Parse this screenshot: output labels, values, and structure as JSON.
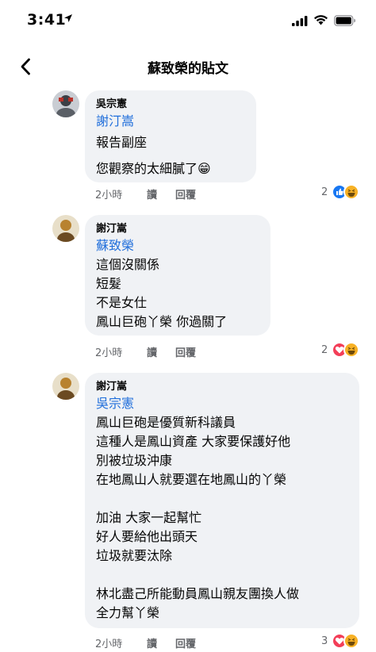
{
  "status": {
    "time": "3:41"
  },
  "nav": {
    "title": "蘇致榮的貼文"
  },
  "comments": [
    {
      "author": "吳宗憲",
      "mention": "謝汀嵩",
      "lines": [
        "報告副座",
        "您觀察的太細膩了😁"
      ],
      "time": "2小時",
      "reply_label": "讀",
      "replies_label": "回覆",
      "reaction_count": "2",
      "reactions": [
        "like",
        "haha"
      ]
    },
    {
      "author": "謝汀嵩",
      "mention": "蘇致榮",
      "lines": [
        "這個沒關係",
        "短髮",
        "不是女仕",
        "鳳山巨砲丫榮 你過關了"
      ],
      "time": "2小時",
      "reply_label": "讀",
      "replies_label": "回覆",
      "reaction_count": "2",
      "reactions": [
        "love",
        "haha"
      ]
    },
    {
      "author": "謝汀嵩",
      "mention": "吳宗憲",
      "lines": [
        "鳳山巨砲是優質新科議員",
        "這種人是鳳山資產 大家要保護好他",
        "別被垃圾沖康",
        "在地鳳山人就要選在地鳳山的丫榮",
        "",
        "加油 大家一起幫忙",
        "好人要給他出頭天",
        "垃圾就要汰除",
        "",
        "林北盡己所能動員鳳山親友團換人做",
        "全力幫丫榮"
      ],
      "time": "2小時",
      "reply_label": "讀",
      "replies_label": "回覆",
      "reaction_count": "3",
      "reactions": [
        "love",
        "haha"
      ]
    }
  ],
  "colors": {
    "mention": "#216fdb",
    "bubble": "#f0f2f5",
    "like": "#1877f2",
    "love": "#f33e58",
    "haha": "#f7b125"
  }
}
